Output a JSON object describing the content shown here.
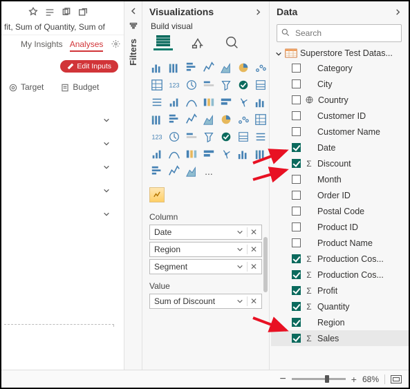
{
  "left": {
    "title_snippet": "fit, Sum of Quantity, Sum of",
    "tabs": {
      "insights": "My Insights",
      "analyses": "Analyses"
    },
    "edit_btn": "Edit Inputs",
    "measures": {
      "target": "Target",
      "budget": "Budget"
    }
  },
  "filters": {
    "label": "Filters"
  },
  "viz": {
    "title": "Visualizations",
    "build_label": "Build visual",
    "values_ellipsis": "...",
    "wells": {
      "column_label": "Column",
      "column_fields": [
        "Date",
        "Region",
        "Segment"
      ],
      "value_label": "Value",
      "value_fields": [
        "Sum of Discount"
      ]
    }
  },
  "data": {
    "title": "Data",
    "search_placeholder": "Search",
    "dataset": "Superstore Test Datas...",
    "fields": [
      {
        "name": "Category",
        "checked": false,
        "icon": ""
      },
      {
        "name": "City",
        "checked": false,
        "icon": ""
      },
      {
        "name": "Country",
        "checked": false,
        "icon": "globe"
      },
      {
        "name": "Customer ID",
        "checked": false,
        "icon": ""
      },
      {
        "name": "Customer Name",
        "checked": false,
        "icon": ""
      },
      {
        "name": "Date",
        "checked": true,
        "icon": ""
      },
      {
        "name": "Discount",
        "checked": true,
        "icon": "sigma"
      },
      {
        "name": "Month",
        "checked": false,
        "icon": ""
      },
      {
        "name": "Order ID",
        "checked": false,
        "icon": ""
      },
      {
        "name": "Postal Code",
        "checked": false,
        "icon": ""
      },
      {
        "name": "Product ID",
        "checked": false,
        "icon": ""
      },
      {
        "name": "Product Name",
        "checked": false,
        "icon": ""
      },
      {
        "name": "Production Cos...",
        "checked": true,
        "icon": "sigma"
      },
      {
        "name": "Production Cos...",
        "checked": true,
        "icon": "sigma"
      },
      {
        "name": "Profit",
        "checked": true,
        "icon": "sigma"
      },
      {
        "name": "Quantity",
        "checked": true,
        "icon": "sigma"
      },
      {
        "name": "Region",
        "checked": true,
        "icon": ""
      },
      {
        "name": "Sales",
        "checked": true,
        "icon": "sigma",
        "selected": true
      }
    ]
  },
  "footer": {
    "zoom": "68%"
  },
  "colors": {
    "teal": "#0b6a5d",
    "red": "#d13438"
  }
}
